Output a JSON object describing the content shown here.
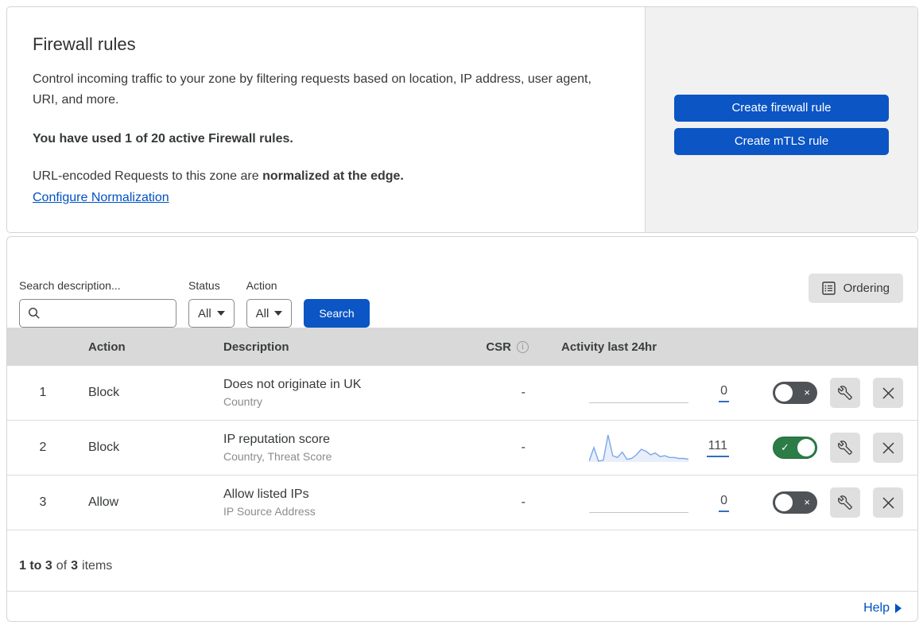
{
  "header": {
    "title": "Firewall rules",
    "description": "Control incoming traffic to your zone by filtering requests based on location, IP address, user agent, URI, and more.",
    "usage_note": "You have used 1 of 20 active Firewall rules.",
    "normalization_text": "URL-encoded Requests to this zone are ",
    "normalization_bold": "normalized at the edge.",
    "normalization_link": "Configure Normalization",
    "create_firewall_button": "Create firewall rule",
    "create_mtls_button": "Create mTLS rule"
  },
  "filters": {
    "search_label": "Search description...",
    "status_label": "Status",
    "status_value": "All",
    "action_label": "Action",
    "action_value": "All",
    "search_button": "Search",
    "ordering_button": "Ordering"
  },
  "table": {
    "columns": {
      "action": "Action",
      "description": "Description",
      "csr": "CSR",
      "csr_info_icon": "i",
      "activity": "Activity last 24hr"
    },
    "rows": [
      {
        "number": "1",
        "action": "Block",
        "description": "Does not originate in UK",
        "fields": "Country",
        "csr": "-",
        "activity_count": "0",
        "enabled": false
      },
      {
        "number": "2",
        "action": "Block",
        "description": "IP reputation score",
        "fields": "Country, Threat Score",
        "csr": "-",
        "activity_count": "111",
        "enabled": true
      },
      {
        "number": "3",
        "action": "Allow",
        "description": "Allow listed IPs",
        "fields": "IP Source Address",
        "csr": "-",
        "activity_count": "0",
        "enabled": false
      }
    ]
  },
  "chart_data": {
    "type": "area",
    "title": "Activity last 24hr sparkline (rule 2)",
    "total_requests": 111,
    "x_range": "last 24 hours",
    "values": [
      1,
      16,
      1,
      2,
      30,
      7,
      5,
      11,
      3,
      4,
      8,
      14,
      12,
      8,
      10,
      6,
      7,
      5,
      5,
      4,
      4,
      3
    ],
    "line_color": "#7da6e8",
    "fill_color": "rgba(125,166,232,0.18)"
  },
  "footer": {
    "count_range": "1 to 3",
    "of_label": "of",
    "total": "3",
    "items_label": "items",
    "help_label": "Help"
  },
  "toggle": {
    "off_glyph": "×",
    "on_glyph": "✓"
  },
  "colors": {
    "primary_blue": "#0b55c4",
    "link_blue": "#0051c3",
    "toggle_on_green": "#2c7c47",
    "toggle_off_gray": "#4f5256",
    "header_band": "#d9d9d9",
    "panel_gray": "#f1f1f1"
  }
}
